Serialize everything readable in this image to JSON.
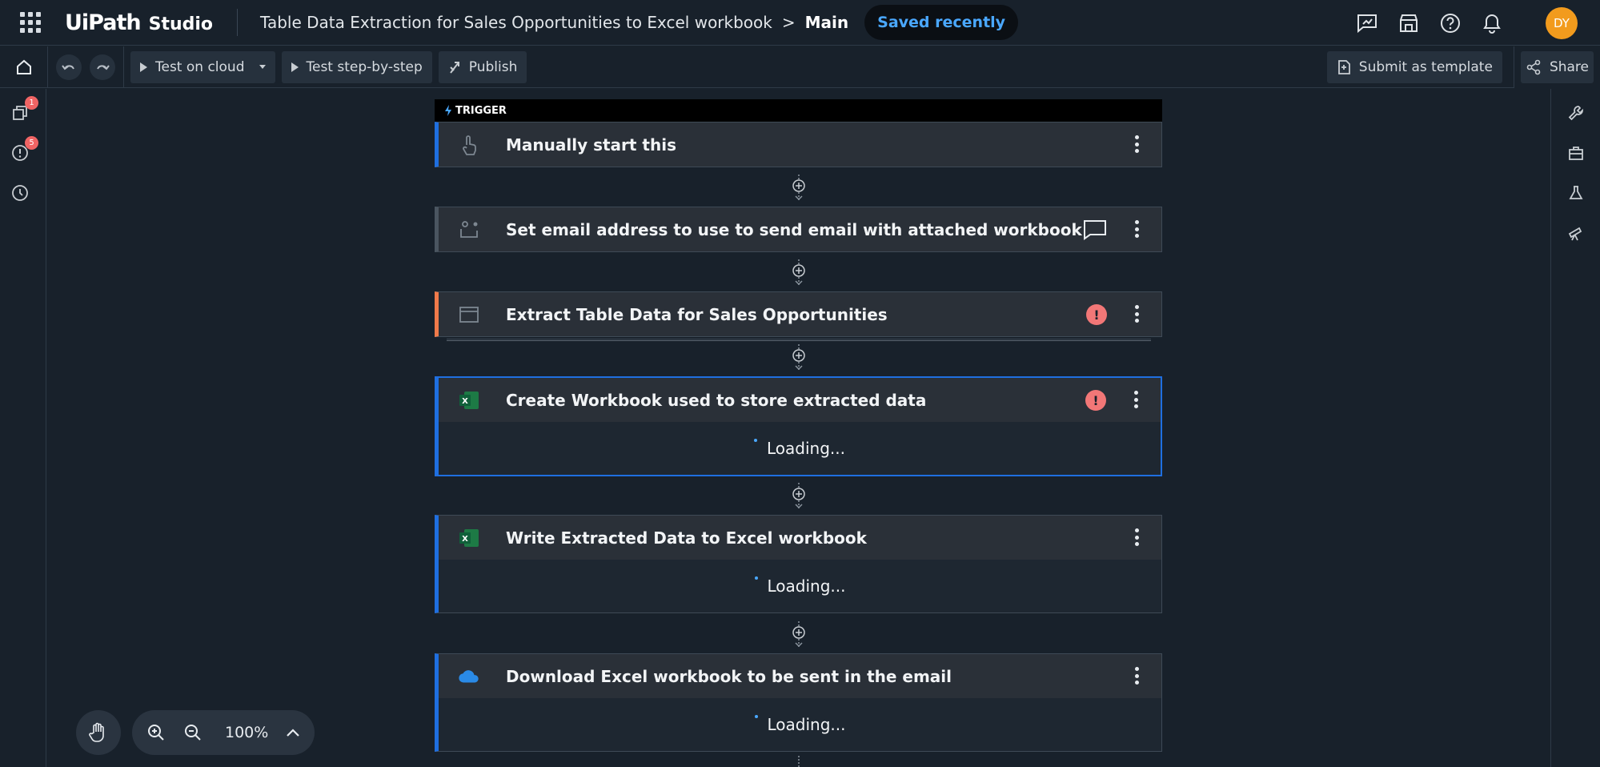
{
  "header": {
    "logo_ui": "UiPath",
    "logo_studio": "Studio",
    "breadcrumb_project": "Table Data Extraction for Sales Opportunities to Excel workbook",
    "breadcrumb_separator": ">",
    "breadcrumb_current": "Main",
    "save_status": "Saved recently",
    "avatar_initials": "DY"
  },
  "toolbar": {
    "test_on_cloud": "Test on cloud",
    "test_step_by_step": "Test step-by-step",
    "publish": "Publish",
    "submit_as_template": "Submit as template",
    "share": "Share"
  },
  "leftbar": {
    "explorer_badge": "1",
    "errors_badge": "5"
  },
  "workflow": {
    "trigger_tag": "TRIGGER",
    "steps": [
      {
        "title": "Manually start this",
        "icon": "hand-pointer-icon",
        "has_error": false,
        "has_comment": false,
        "body": "",
        "accent": "#1f6fe0"
      },
      {
        "title": "Set email address to use to send email with attached workbook",
        "icon": "variable-icon",
        "has_error": false,
        "has_comment": true,
        "body": "",
        "accent": "#4a5560"
      },
      {
        "title": "Extract Table Data for Sales Opportunities",
        "icon": "browser-window-icon",
        "has_error": true,
        "has_comment": false,
        "body": "",
        "accent": "#f07a4a"
      },
      {
        "title": "Create Workbook used to store extracted data",
        "icon": "excel-icon",
        "has_error": true,
        "has_comment": false,
        "body": "Loading...",
        "accent": "#1f6fe0"
      },
      {
        "title": "Write Extracted Data to Excel workbook",
        "icon": "excel-icon",
        "has_error": false,
        "has_comment": false,
        "body": "Loading...",
        "accent": "#1f6fe0"
      },
      {
        "title": "Download Excel workbook to be sent in the email",
        "icon": "onedrive-icon",
        "has_error": false,
        "has_comment": false,
        "body": "Loading...",
        "accent": "#1f6fe0"
      }
    ]
  },
  "zoom": {
    "level": "100%"
  },
  "colors": {
    "accent_blue": "#1f6fe0",
    "error_red": "#f27777",
    "saved_text": "#4aa8ff",
    "avatar": "#f29b1d"
  }
}
